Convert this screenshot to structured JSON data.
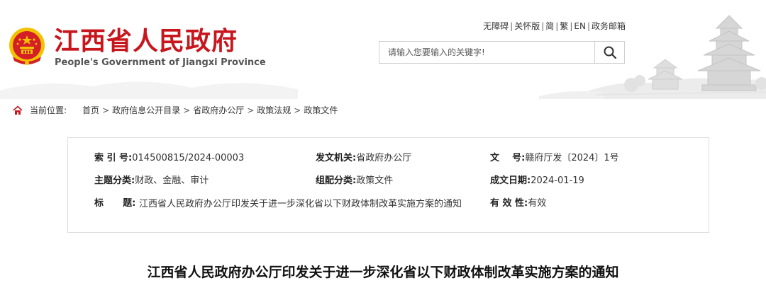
{
  "header": {
    "site_title": "江西省人民政府",
    "site_subtitle": "People's Government of Jiangxi Province",
    "top_links": [
      "无障碍",
      "关怀版",
      "简",
      "繁",
      "EN",
      "政务邮箱"
    ],
    "search_placeholder": "请输入您要输入的关键字!"
  },
  "breadcrumb": {
    "label": "当前位置:",
    "items": [
      "首页",
      "政府信息公开目录",
      "省政府办公厅",
      "政策法规",
      "政策文件"
    ]
  },
  "info": {
    "index_label": "索 引 号:",
    "index_value": "014500815/2024-00003",
    "issuer_label": "发文机关:",
    "issuer_value": "省政府办公厅",
    "docnum_label": "文    号:",
    "docnum_value": "赣府厅发〔2024〕1号",
    "topic_label": "主题分类:",
    "topic_value": "财政、金融、审计",
    "genre_label": "组配分类:",
    "genre_value": "政策文件",
    "date_label": "成文日期:",
    "date_value": "2024-01-19",
    "title_label": "标      题:",
    "title_value": "江西省人民政府办公厅印发关于进一步深化省以下财政体制改革实施方案的通知",
    "validity_label": "有 效 性:",
    "validity_value": "有效"
  },
  "document": {
    "title": "江西省人民政府办公厅印发关于进一步深化省以下财政体制改革实施方案的通知"
  },
  "colors": {
    "brand_red": "#c8161d",
    "emblem_gold": "#f2c200",
    "border": "#dcdcdc"
  }
}
